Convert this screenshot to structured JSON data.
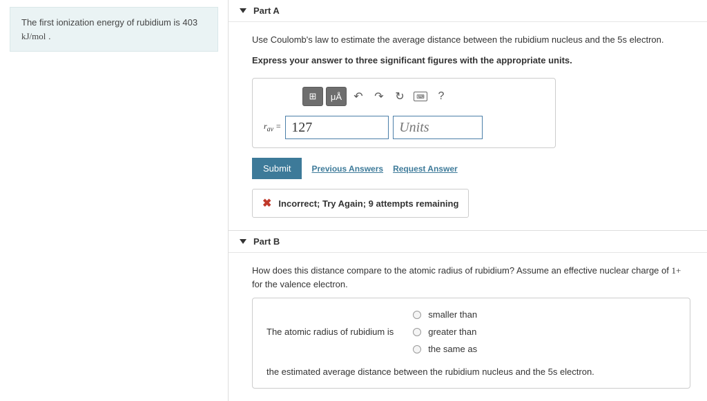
{
  "sidebar": {
    "info_text_1": "The first ionization energy of rubidium is 403 ",
    "info_text_unit": "kJ/mol",
    "info_text_2": " ."
  },
  "partA": {
    "title": "Part A",
    "instruction": "Use Coulomb's law to estimate the average distance between the rubidium nucleus and the 5s electron.",
    "express": "Express your answer to three significant figures with the appropriate units.",
    "toolbar": {
      "templates_label": "⊞",
      "units_label": "μÅ",
      "help_label": "?"
    },
    "var_label": "r",
    "var_sub": "av",
    "equals": " = ",
    "value": "127",
    "units_placeholder": "Units",
    "submit_label": "Submit",
    "prev_answers": "Previous Answers",
    "request_answer": "Request Answer",
    "feedback": "Incorrect; Try Again; 9 attempts remaining"
  },
  "partB": {
    "title": "Part B",
    "instruction_1": "How does this distance compare to the atomic radius of rubidium? Assume an effective nuclear charge of ",
    "instruction_charge": "1+",
    "instruction_2": "  for the valence electron.",
    "lead_text": "The atomic radius of rubidium is",
    "options": [
      "smaller than",
      "greater than",
      "the same as"
    ],
    "trail_text": "the estimated average distance between the rubidium nucleus and the 5s electron."
  }
}
